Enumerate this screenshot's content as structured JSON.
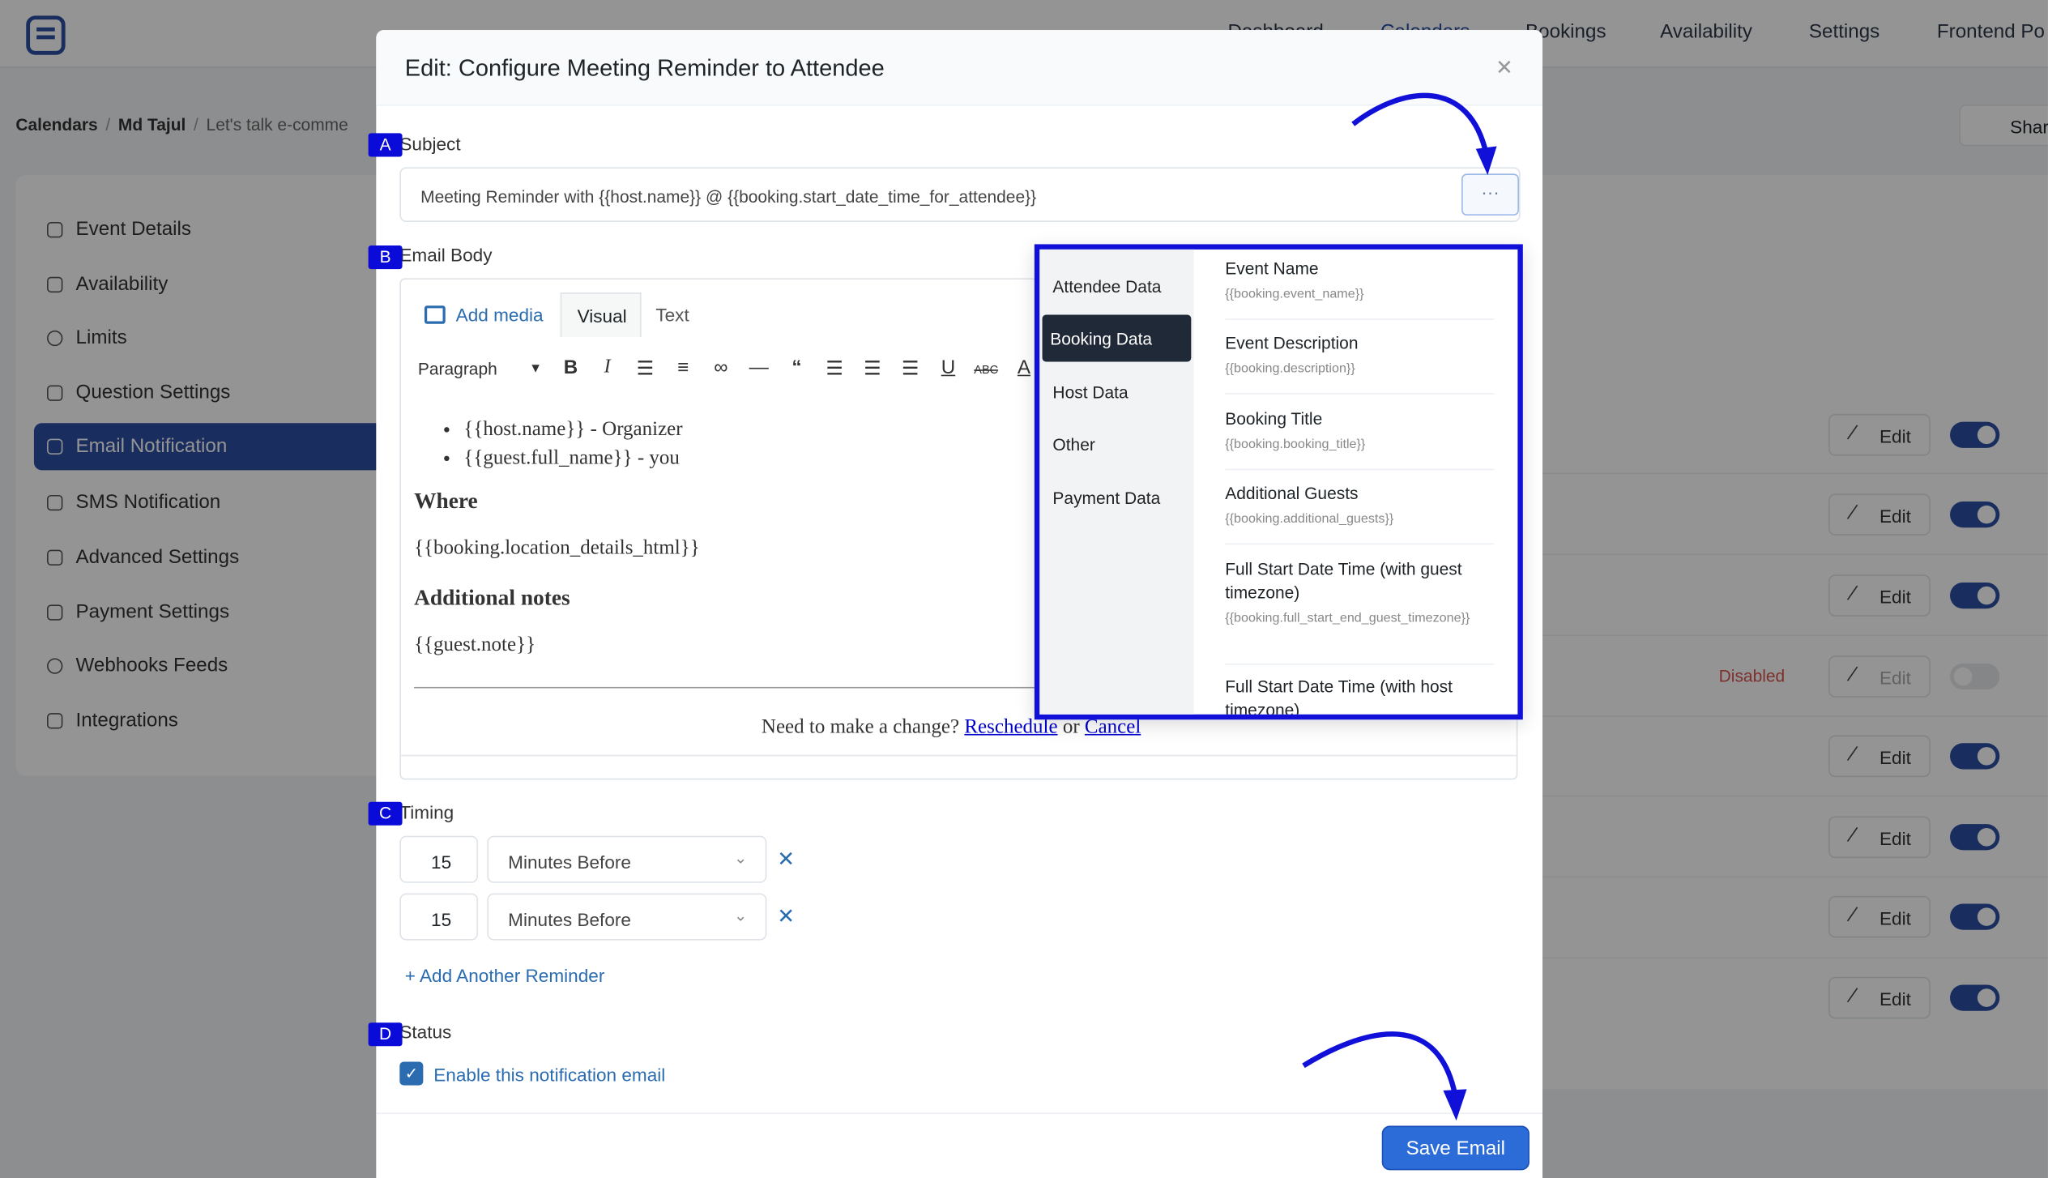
{
  "nav": {
    "items": [
      "Dashboard",
      "Calendars",
      "Bookings",
      "Availability",
      "Settings",
      "Frontend Po"
    ]
  },
  "breadcrumb": {
    "root": "Calendars",
    "user": "Md Tajul",
    "current": "Let's talk e-comme"
  },
  "share_label": "Shar",
  "sidebar": {
    "items": [
      {
        "label": "Event Details"
      },
      {
        "label": "Availability"
      },
      {
        "label": "Limits"
      },
      {
        "label": "Question Settings"
      },
      {
        "label": "Email Notification"
      },
      {
        "label": "SMS Notification"
      },
      {
        "label": "Advanced Settings"
      },
      {
        "label": "Payment Settings"
      },
      {
        "label": "Webhooks Feeds"
      },
      {
        "label": "Integrations"
      }
    ],
    "active": "Email Notification"
  },
  "background_rows": {
    "edit_label": "Edit",
    "disabled_label": "Disabled"
  },
  "modal": {
    "title": "Edit: Configure Meeting Reminder to Attendee",
    "markers": {
      "a": "A",
      "b": "B",
      "c": "C",
      "d": "D"
    },
    "subject_label": "Subject",
    "subject_value": "Meeting Reminder with {{host.name}} @ {{booking.start_date_time_for_attendee}}",
    "dots_label": "···",
    "email_body_label": "Email Body",
    "editor": {
      "add_media": "Add media",
      "tab_visual": "Visual",
      "tab_text": "Text",
      "format": "Paragraph",
      "bullets": [
        "{{host.name}} - Organizer",
        "{{guest.full_name}} - you"
      ],
      "where_heading": "Where",
      "location": "{{booking.location_details_html}}",
      "notes_heading": "Additional notes",
      "note": "{{guest.note}}",
      "change_prefix": "Need to make a change?",
      "reschedule": "Reschedule",
      "or": "or",
      "cancel": "Cancel"
    },
    "variables": {
      "categories": [
        "Attendee Data",
        "Booking Data",
        "Host Data",
        "Other",
        "Payment Data"
      ],
      "selected": "Booking Data",
      "items": [
        {
          "name": "Event Name",
          "code": "{{booking.event_name}}"
        },
        {
          "name": "Event Description",
          "code": "{{booking.description}}"
        },
        {
          "name": "Booking Title",
          "code": "{{booking.booking_title}}"
        },
        {
          "name": "Additional Guests",
          "code": "{{booking.additional_guests}}"
        },
        {
          "name": "Full Start Date Time (with guest timezone)",
          "code": "{{booking.full_start_end_guest_timezone}}"
        },
        {
          "name": "Full Start Date Time (with host timezone)",
          "code": ""
        }
      ]
    },
    "timing_label": "Timing",
    "reminders": [
      {
        "value": "15",
        "unit": "Minutes Before"
      },
      {
        "value": "15",
        "unit": "Minutes Before"
      }
    ],
    "remove_icon": "✕",
    "add_reminder": "+ Add Another Reminder",
    "status_label": "Status",
    "enable_label": "Enable this notification email",
    "save_label": "Save Email"
  },
  "colors": {
    "primary": "#2b4fa3",
    "link": "#2b6cb0",
    "annotation": "#1010d8",
    "save": "#2b6cd8"
  }
}
